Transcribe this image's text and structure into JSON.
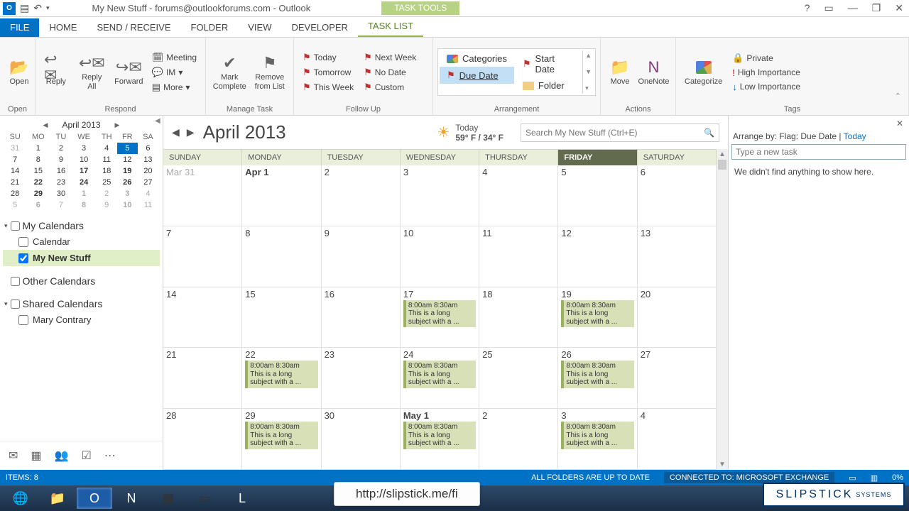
{
  "title": "My New Stuff - forums@outlookforums.com - Outlook",
  "tooltab": "TASK TOOLS",
  "tabs": {
    "file": "FILE",
    "home": "HOME",
    "sendrecv": "SEND / RECEIVE",
    "folder": "FOLDER",
    "view": "VIEW",
    "developer": "DEVELOPER",
    "tasklist": "TASK LIST"
  },
  "ribbon": {
    "open": {
      "label": "Open",
      "btn": "Open"
    },
    "respond": {
      "label": "Respond",
      "reply": "Reply",
      "replyall": "Reply All",
      "forward": "Forward",
      "meeting": "Meeting",
      "im": "IM",
      "more": "More"
    },
    "manage": {
      "label": "Manage Task",
      "mark": "Mark Complete",
      "remove": "Remove from List"
    },
    "followup": {
      "label": "Follow Up",
      "today": "Today",
      "tomorrow": "Tomorrow",
      "thisweek": "This Week",
      "nextweek": "Next Week",
      "nodate": "No Date",
      "custom": "Custom"
    },
    "arrangement": {
      "label": "Arrangement",
      "categories": "Categories",
      "startdate": "Start Date",
      "duedate": "Due Date",
      "folder": "Folder"
    },
    "actions": {
      "label": "Actions",
      "move": "Move",
      "onenote": "OneNote"
    },
    "tags": {
      "label": "Tags",
      "categorize": "Categorize",
      "private": "Private",
      "high": "High Importance",
      "low": "Low Importance"
    }
  },
  "minical": {
    "month": "April 2013",
    "dow": [
      "SU",
      "MO",
      "TU",
      "WE",
      "TH",
      "FR",
      "SA"
    ],
    "rows": [
      [
        {
          "d": "31",
          "dim": true
        },
        {
          "d": "1"
        },
        {
          "d": "2"
        },
        {
          "d": "3"
        },
        {
          "d": "4"
        },
        {
          "d": "5",
          "sel": true
        },
        {
          "d": "6"
        }
      ],
      [
        {
          "d": "7"
        },
        {
          "d": "8"
        },
        {
          "d": "9"
        },
        {
          "d": "10"
        },
        {
          "d": "11"
        },
        {
          "d": "12"
        },
        {
          "d": "13"
        }
      ],
      [
        {
          "d": "14"
        },
        {
          "d": "15"
        },
        {
          "d": "16"
        },
        {
          "d": "17",
          "b": true
        },
        {
          "d": "18"
        },
        {
          "d": "19",
          "b": true
        },
        {
          "d": "20"
        }
      ],
      [
        {
          "d": "21"
        },
        {
          "d": "22",
          "b": true
        },
        {
          "d": "23"
        },
        {
          "d": "24",
          "b": true
        },
        {
          "d": "25"
        },
        {
          "d": "26",
          "b": true
        },
        {
          "d": "27"
        }
      ],
      [
        {
          "d": "28"
        },
        {
          "d": "29",
          "b": true
        },
        {
          "d": "30"
        },
        {
          "d": "1",
          "b": true,
          "dim": true
        },
        {
          "d": "2",
          "dim": true
        },
        {
          "d": "3",
          "b": true,
          "dim": true
        },
        {
          "d": "4",
          "dim": true
        }
      ],
      [
        {
          "d": "5",
          "dim": true
        },
        {
          "d": "6",
          "dim": true,
          "b": true
        },
        {
          "d": "7",
          "dim": true
        },
        {
          "d": "8",
          "dim": true,
          "b": true
        },
        {
          "d": "9",
          "dim": true
        },
        {
          "d": "10",
          "dim": true,
          "b": true
        },
        {
          "d": "11",
          "dim": true
        }
      ]
    ]
  },
  "calgroups": {
    "my": {
      "title": "My Calendars",
      "cal": "Calendar",
      "mynew": "My New Stuff"
    },
    "other": "Other Calendars",
    "shared": {
      "title": "Shared Calendars",
      "mary": "Mary Contrary"
    }
  },
  "calview": {
    "month": "April 2013",
    "weather": {
      "today": "Today",
      "temp": "59° F / 34° F"
    },
    "search_ph": "Search My New Stuff (Ctrl+E)",
    "dow": [
      "SUNDAY",
      "MONDAY",
      "TUESDAY",
      "WEDNESDAY",
      "THURSDAY",
      "FRIDAY",
      "SATURDAY"
    ],
    "rows": [
      [
        {
          "d": "Mar 31",
          "dim": true
        },
        {
          "d": "Apr 1",
          "bm": true
        },
        {
          "d": "2"
        },
        {
          "d": "3"
        },
        {
          "d": "4"
        },
        {
          "d": "5"
        },
        {
          "d": "6"
        }
      ],
      [
        {
          "d": "7"
        },
        {
          "d": "8"
        },
        {
          "d": "9"
        },
        {
          "d": "10"
        },
        {
          "d": "11"
        },
        {
          "d": "12"
        },
        {
          "d": "13"
        }
      ],
      [
        {
          "d": "14"
        },
        {
          "d": "15"
        },
        {
          "d": "16"
        },
        {
          "d": "17",
          "a": true
        },
        {
          "d": "18"
        },
        {
          "d": "19",
          "a": true
        },
        {
          "d": "20"
        }
      ],
      [
        {
          "d": "21"
        },
        {
          "d": "22",
          "a": true
        },
        {
          "d": "23"
        },
        {
          "d": "24",
          "a": true
        },
        {
          "d": "25"
        },
        {
          "d": "26",
          "a": true
        },
        {
          "d": "27"
        }
      ],
      [
        {
          "d": "28"
        },
        {
          "d": "29",
          "a": true
        },
        {
          "d": "30"
        },
        {
          "d": "May 1",
          "bm": true,
          "a": true
        },
        {
          "d": "2"
        },
        {
          "d": "3",
          "a": true
        },
        {
          "d": "4"
        }
      ]
    ],
    "appt": {
      "time": "8:00am 8:30am",
      "subj": "This is a long subject with a ..."
    }
  },
  "taskpane": {
    "arrby": "Arrange by: Flag: Due Date",
    "today": "Today",
    "newtask_ph": "Type a new task",
    "empty": "We didn't find anything to show here."
  },
  "status": {
    "items": "ITEMS: 8",
    "folders": "ALL FOLDERS ARE UP TO DATE",
    "conn": "CONNECTED TO: MICROSOFT EXCHANGE",
    "zoom": "0%"
  },
  "url": "http://slipstick.me/fi",
  "logo": "SLIPSTICK"
}
